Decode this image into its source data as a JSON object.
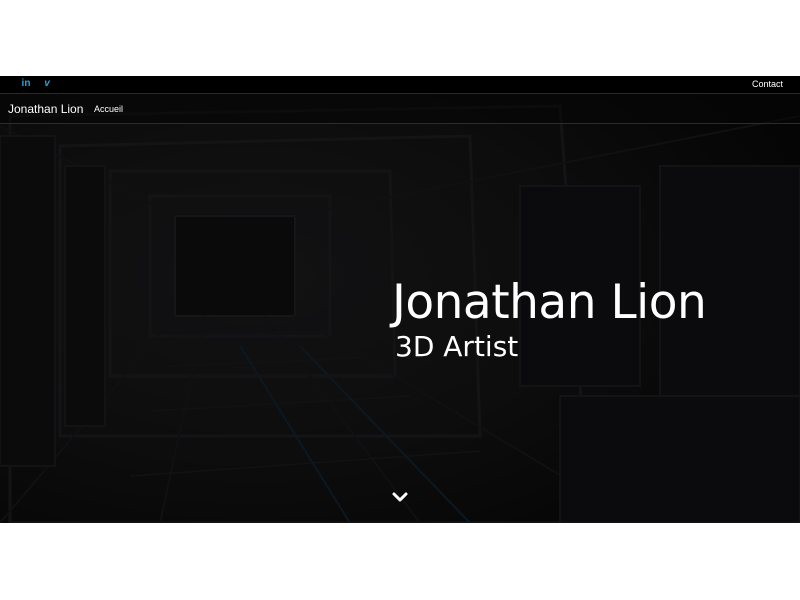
{
  "topbar": {
    "social": [
      {
        "label": "in",
        "icon": "linkedin-icon"
      },
      {
        "label": "v",
        "icon": "vimeo-icon"
      }
    ],
    "contact_label": "Contact",
    "accent_color": "#2aa3e0"
  },
  "nav": {
    "brand": "Jonathan Lion",
    "links": [
      "Accueil"
    ]
  },
  "hero": {
    "title": "Jonathan Lion",
    "subtitle": "3D Artist",
    "scroll_icon": "chevron-down-icon",
    "background": "dark sci-fi corridor"
  }
}
